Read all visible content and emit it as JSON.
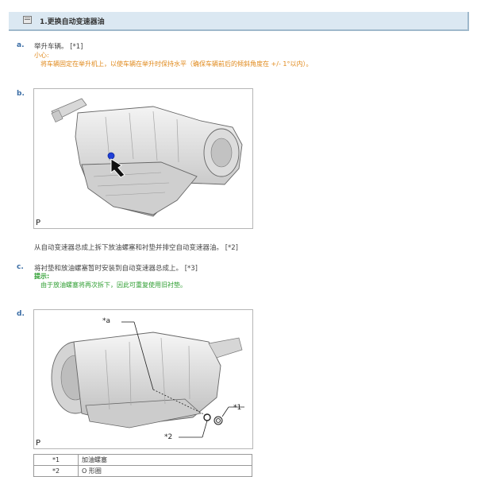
{
  "section": {
    "title": "1.更换自动变速器油"
  },
  "steps": [
    {
      "letter": "a.",
      "text": "举升车辆。 [*1]"
    },
    {
      "letter": "b."
    },
    {
      "letter": "c.",
      "text": "将衬垫和放油螺塞暂时安装到自动变速器总成上。 [*3]"
    },
    {
      "letter": "d."
    }
  ],
  "caution": {
    "label": "小心:",
    "text": "将车辆固定在举升机上，以使车辆在举升时保持水平（确保车辆前后的倾斜角度在 +/- 1°以内）。"
  },
  "figure_b": {
    "code": "P",
    "caption": "从自动变速器总成上拆下放油螺塞和衬垫并排空自动变速器油。 [*2]"
  },
  "hint": {
    "label": "提示:",
    "text": "由于放油螺塞将再次拆下，因此可重复使用旧衬垫。"
  },
  "figure_d": {
    "code": "P",
    "callouts": {
      "a": "*a",
      "one": "*1",
      "two": "*2"
    }
  },
  "legend": [
    {
      "code": "*1",
      "desc": "加油螺塞"
    },
    {
      "code": "*2",
      "desc": "O 形圈"
    }
  ],
  "colors": {
    "step_letter": "#3b6da5",
    "caution": "#e0891b",
    "hint": "#2e9e31",
    "title_bar": "#dbe8f2"
  }
}
